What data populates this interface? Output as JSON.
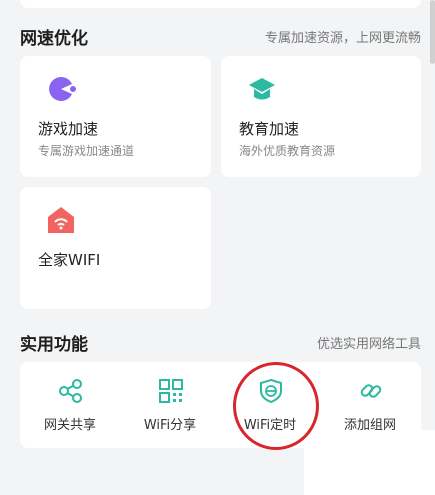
{
  "speed_section": {
    "title": "网速优化",
    "subtitle": "专属加速资源，上网更流畅"
  },
  "speed_cards": [
    {
      "title": "游戏加速",
      "desc": "专属游戏加速通道",
      "icon": "game-icon",
      "color": "#8a63f0"
    },
    {
      "title": "教育加速",
      "desc": "海外优质教育资源",
      "icon": "graduation-cap-icon",
      "color": "#2bb9a1"
    },
    {
      "title": "全家WIFI",
      "desc": "",
      "icon": "home-wifi-icon",
      "color": "#f26462"
    }
  ],
  "tools_section": {
    "title": "实用功能",
    "subtitle": "优选实用网络工具"
  },
  "tools": [
    {
      "label": "网关共享",
      "icon": "share-icon"
    },
    {
      "label": "WiFi分享",
      "icon": "qr-code-icon"
    },
    {
      "label": "WiFi定时",
      "icon": "shield-timer-icon"
    },
    {
      "label": "添加组网",
      "icon": "link-icon"
    }
  ],
  "colors": {
    "accent": "#2bb9a1",
    "highlight_circle": "#d9262b"
  }
}
